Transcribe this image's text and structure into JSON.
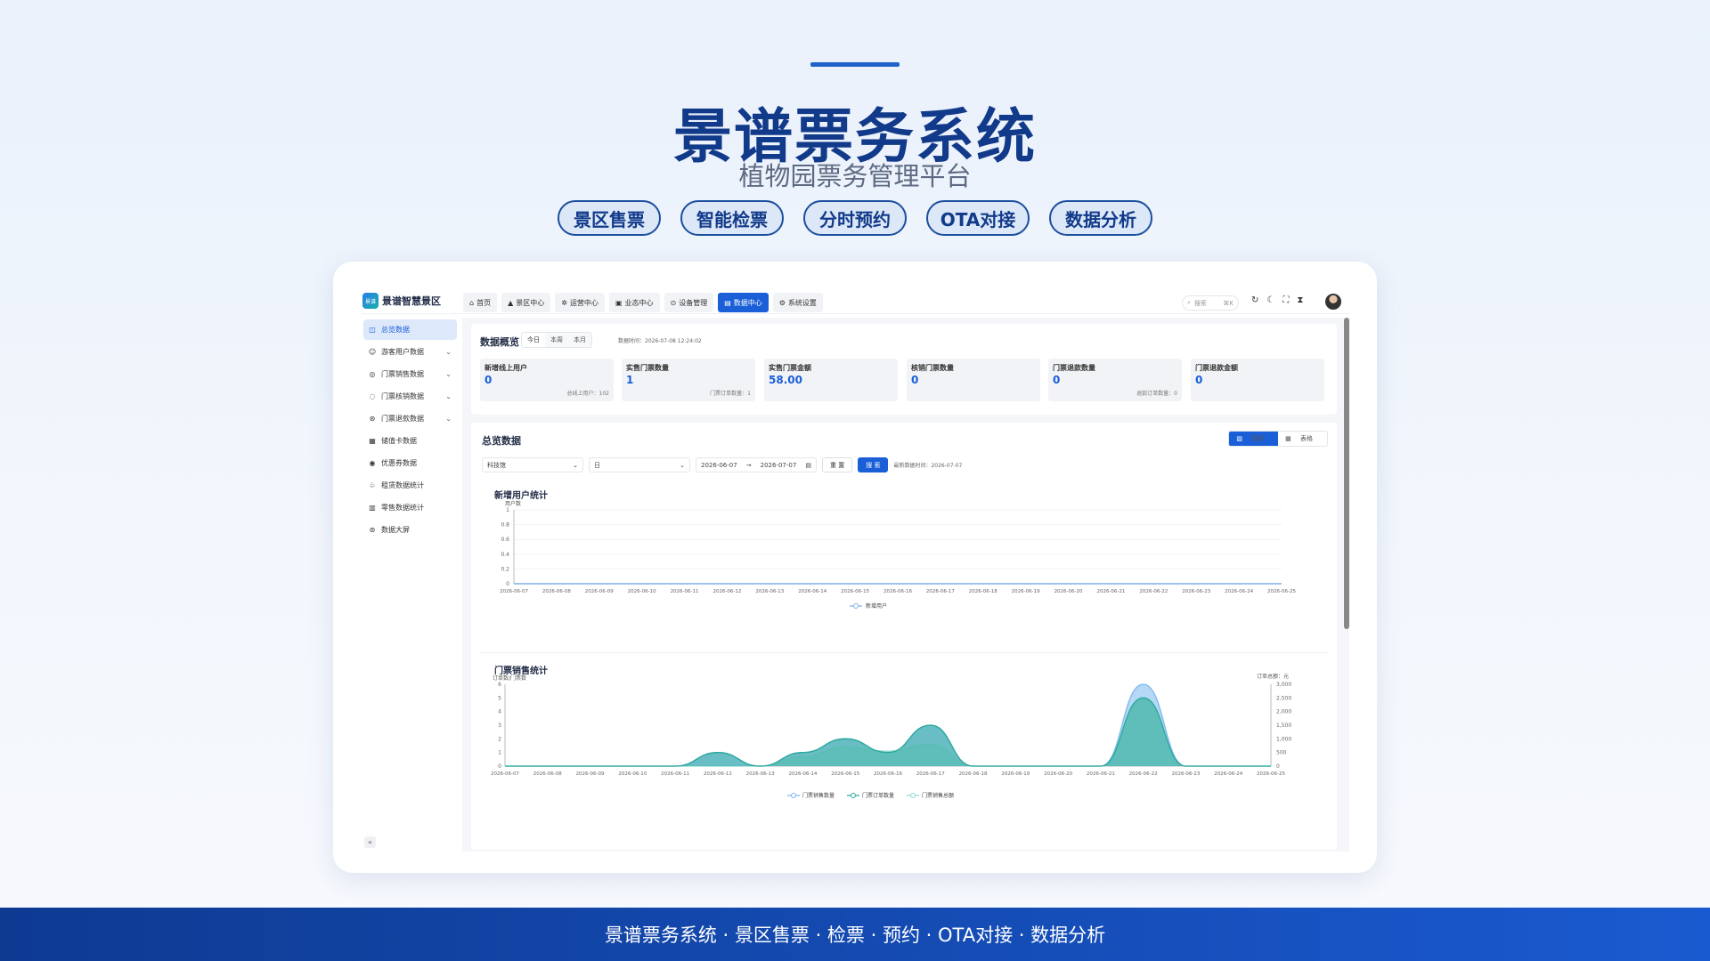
{
  "hero": {
    "title": "景谱票务系统",
    "subtitle": "植物园票务管理平台",
    "pills": [
      "景区售票",
      "智能检票",
      "分时预约",
      "OTA对接",
      "数据分析"
    ]
  },
  "app": {
    "logo_mark": "景谱",
    "logo_text": "景谱智慧景区",
    "nav": [
      "首页",
      "景区中心",
      "运营中心",
      "业态中心",
      "设备管理",
      "数据中心",
      "系统设置"
    ],
    "nav_active_index": 5,
    "search_placeholder": "搜索",
    "search_shortcut": "⌘K",
    "sidebar": [
      {
        "label": "总览数据",
        "active": true,
        "chevron": false
      },
      {
        "label": "游客用户数据",
        "chevron": true
      },
      {
        "label": "门票销售数据",
        "chevron": true
      },
      {
        "label": "门票核销数据",
        "chevron": true
      },
      {
        "label": "门票退款数据",
        "chevron": true
      },
      {
        "label": "储值卡数据",
        "chevron": false
      },
      {
        "label": "优惠券数据",
        "chevron": false
      },
      {
        "label": "租赁数据统计",
        "chevron": false
      },
      {
        "label": "零售数据统计",
        "chevron": false
      },
      {
        "label": "数据大屏",
        "chevron": false
      }
    ],
    "collapse_label": "«"
  },
  "overview": {
    "title": "数据概览",
    "ranges": [
      "今日",
      "本周",
      "本月"
    ],
    "timestamp": "数据时间：2026-07-08 12:24:02",
    "stats": [
      {
        "label": "新增线上用户",
        "value": "0",
        "sub": "总线上用户：102"
      },
      {
        "label": "实售门票数量",
        "value": "1",
        "sub": "门票订单数量：1"
      },
      {
        "label": "实售门票金额",
        "value": "58.00",
        "sub": ""
      },
      {
        "label": "核销门票数量",
        "value": "0",
        "sub": ""
      },
      {
        "label": "门票退款数量",
        "value": "0",
        "sub": "退款订单数量：0"
      },
      {
        "label": "门票退款金额",
        "value": "0",
        "sub": ""
      }
    ]
  },
  "summary": {
    "title": "总览数据",
    "view_chart": "图表",
    "view_table": "表格",
    "venue": "科技馆",
    "granularity": "日",
    "date_start": "2026-06-07",
    "date_sep": "→",
    "date_end": "2026-07-07",
    "reset_label": "重 置",
    "search_label": "搜 索",
    "latest": "最新数据时间：2026-07-07"
  },
  "chart_data": [
    {
      "type": "line",
      "title": "新增用户统计",
      "ylabel": "用户数",
      "ylim": [
        0,
        1
      ],
      "yticks": [
        "1",
        "0.8",
        "0.6",
        "0.4",
        "0.2",
        "0"
      ],
      "x": [
        "2026-06-07",
        "2026-06-08",
        "2026-06-09",
        "2026-06-10",
        "2026-06-11",
        "2026-06-12",
        "2026-06-13",
        "2026-06-14",
        "2026-06-15",
        "2026-06-16",
        "2026-06-17",
        "2026-06-18",
        "2026-06-19",
        "2026-06-20",
        "2026-06-21",
        "2026-06-22",
        "2026-06-23",
        "2026-06-24",
        "2026-06-25"
      ],
      "series": [
        {
          "name": "新增用户",
          "values": [
            0,
            0,
            0,
            0,
            0,
            0,
            0,
            0,
            0,
            0,
            0,
            0,
            0,
            0,
            0,
            0,
            0,
            0,
            0
          ],
          "color": "#7fb0e8"
        }
      ],
      "legend": "bottom"
    },
    {
      "type": "area",
      "title": "门票销售统计",
      "ylabel": "订单数/门票数",
      "ylabel_right": "订单总额：元",
      "ylim": [
        0,
        6
      ],
      "ylim_right": [
        0,
        3000
      ],
      "yticks": [
        "6",
        "5",
        "4",
        "3",
        "2",
        "1",
        "0"
      ],
      "yticks_right": [
        "3,000",
        "2,500",
        "2,000",
        "1,500",
        "1,000",
        "500",
        "0"
      ],
      "x": [
        "2026-06-07",
        "2026-06-08",
        "2026-06-09",
        "2026-06-10",
        "2026-06-11",
        "2026-06-12",
        "2026-06-13",
        "2026-06-14",
        "2026-06-15",
        "2026-06-16",
        "2026-06-17",
        "2026-06-18",
        "2026-06-19",
        "2026-06-20",
        "2026-06-21",
        "2026-06-22",
        "2026-06-23",
        "2026-06-24",
        "2026-06-25"
      ],
      "series": [
        {
          "name": "门票销售数量",
          "values": [
            0,
            0,
            0,
            0,
            0,
            1,
            0,
            1,
            2,
            1,
            3,
            0,
            0,
            0,
            0,
            6,
            0,
            0,
            0
          ],
          "color": "#7ab8f0"
        },
        {
          "name": "门票订单数量",
          "values": [
            0,
            0,
            0,
            0,
            0,
            1,
            0,
            1,
            2,
            1,
            3,
            0,
            0,
            0,
            0,
            5,
            0,
            0,
            0
          ],
          "color": "#2aa89a"
        },
        {
          "name": "门票销售总额",
          "values": [
            0,
            0,
            0,
            0,
            0,
            0,
            0,
            350,
            700,
            550,
            800,
            0,
            0,
            0,
            0,
            2500,
            0,
            0,
            0
          ],
          "color": "#8fdad0"
        }
      ],
      "legend": "bottom"
    }
  ],
  "footer": "景谱票务系统 · 景区售票 · 检票 · 预约 · OTA对接 · 数据分析"
}
